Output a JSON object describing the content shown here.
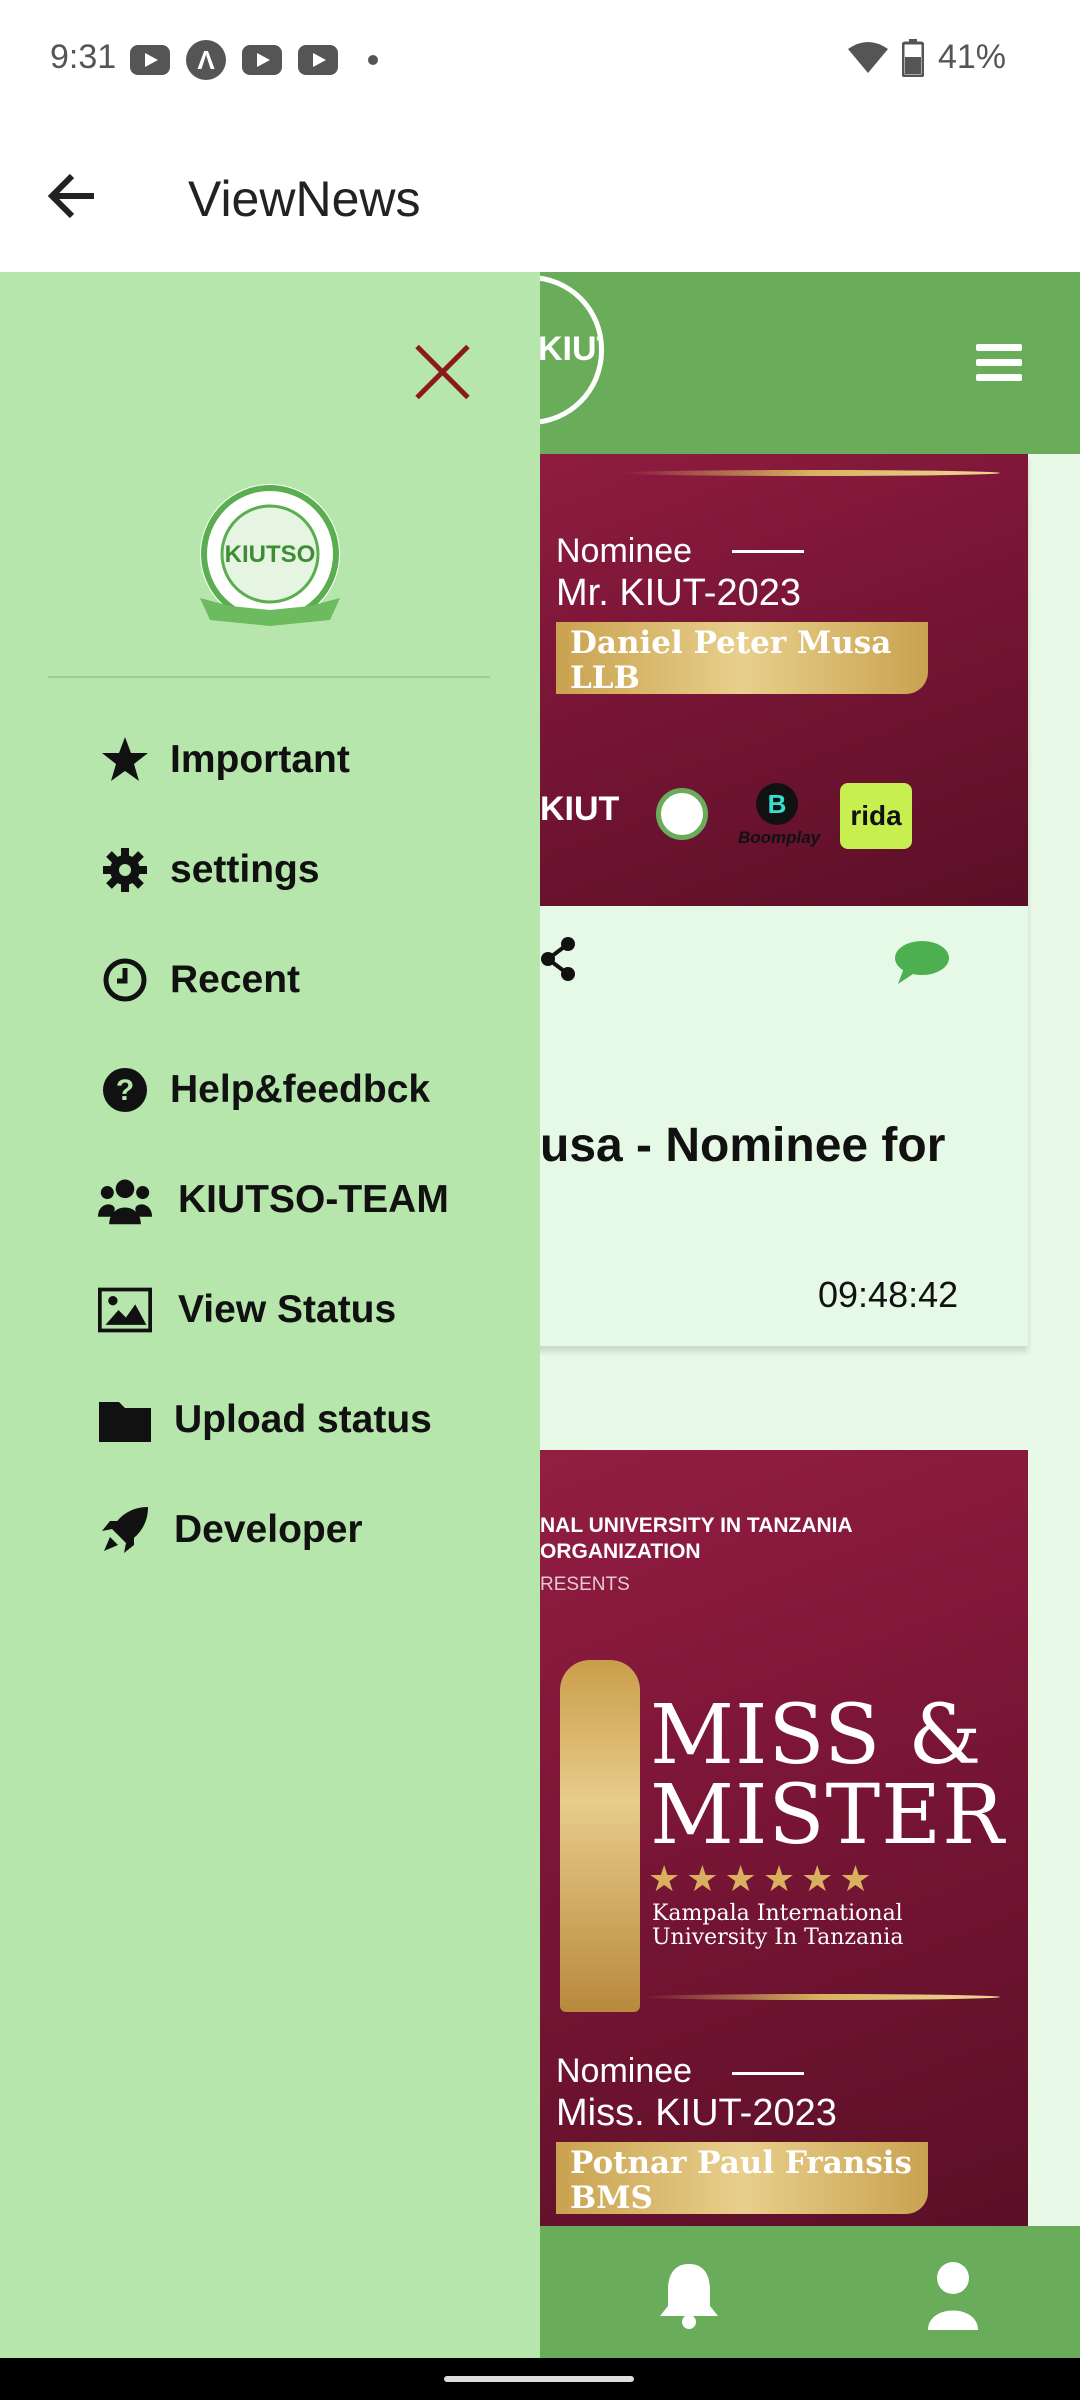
{
  "status_bar": {
    "time": "9:31",
    "battery": "41%",
    "icons": [
      "youtube-icon",
      "android-auto-icon",
      "youtube-icon",
      "youtube-icon",
      "dot-icon",
      "wifi-icon",
      "battery-icon"
    ]
  },
  "app_bar": {
    "title": "ViewNews",
    "back_icon": "arrow-left-icon"
  },
  "drawer": {
    "close_icon": "close-icon",
    "logo_text": "KIUTSO",
    "items": [
      {
        "label": "Important",
        "icon": "star-icon"
      },
      {
        "label": "settings",
        "icon": "gear-icon"
      },
      {
        "label": "Recent",
        "icon": "clock-icon"
      },
      {
        "label": "Help&feedbck",
        "icon": "help-icon"
      },
      {
        "label": "KIUTSO-TEAM",
        "icon": "group-icon"
      },
      {
        "label": "View Status",
        "icon": "image-icon"
      },
      {
        "label": "Upload status",
        "icon": "folder-icon"
      },
      {
        "label": "Developer",
        "icon": "rocket-icon"
      }
    ]
  },
  "feed": {
    "post1": {
      "poster": {
        "nominee": "Nominee",
        "title": "Mr. KIUT-2023",
        "name_line1": "Daniel Peter Musa",
        "name_line2": "LLB",
        "sponsors": {
          "kiut": "KIUT",
          "boomplay": "Boomplay",
          "rida": "rida",
          "boom_glyph": "B"
        }
      },
      "headline": "usa - Nominee for",
      "time": "09:48:42"
    },
    "post2": {
      "poster": {
        "org_line1": "NAL  UNIVERSITY IN TANZANIA",
        "org_line2": " ORGANIZATION",
        "presents": "RESENTS",
        "brand_line1": "MISS &",
        "brand_line2": "MISTER",
        "stars": "★★★★★★",
        "university_line1": "Kampala International",
        "university_line2": "University In Tanzania",
        "nominee": "Nominee",
        "title": "Miss. KIUT-2023",
        "name_line1": "Potnar Paul Fransis",
        "name_line2": "BMS"
      }
    }
  },
  "bottom_nav": {
    "items": [
      "bell-icon",
      "person-icon"
    ]
  },
  "colors": {
    "drawer_bg": "#b6e6ab",
    "accent_green": "#69ad5a",
    "poster_maroon": "#7d1638",
    "close_red": "#8b1a1a"
  }
}
